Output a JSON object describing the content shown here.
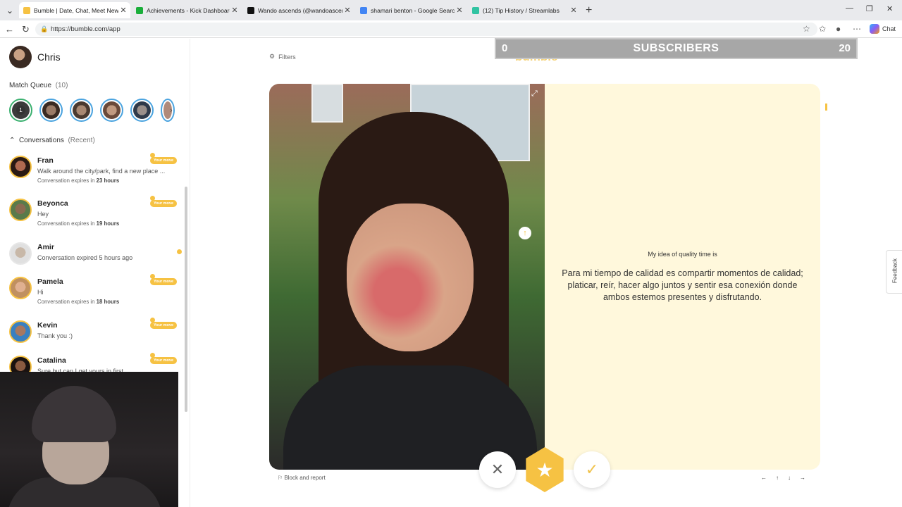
{
  "browser": {
    "tabs": [
      {
        "title": "Bumble | Date, Chat, Meet New Pe",
        "favicon": "bumble-icon",
        "color": "#f6c243",
        "active": true
      },
      {
        "title": "Achievements - Kick Dashboard",
        "favicon": "kick-icon",
        "color": "#1aae3a",
        "active": false
      },
      {
        "title": "Wando ascends (@wandoascends",
        "favicon": "tiktok-icon",
        "color": "#111111",
        "active": false
      },
      {
        "title": "shamari benton - Google Search",
        "favicon": "google-icon",
        "color": "#4285f4",
        "active": false
      },
      {
        "title": "(12) Tip History / Streamlabs",
        "favicon": "streamlabs-icon",
        "color": "#31c3a2",
        "active": false
      }
    ],
    "url": "https://bumble.com/app",
    "chat_label": "Chat"
  },
  "sidebar": {
    "user_name": "Chris",
    "match_queue_label": "Match Queue",
    "match_queue_count": "(10)",
    "queue_badge": "1",
    "conversations_label": "Conversations",
    "conversations_filter": "(Recent)",
    "your_move_label": "Your move",
    "conversations": [
      {
        "name": "Fran",
        "message": "Walk around the city/park, find a new place ...",
        "expiry_prefix": "Conversation expires in",
        "expiry": "23 hours",
        "your_move": true
      },
      {
        "name": "Beyonca",
        "message": "Hey",
        "expiry_prefix": "Conversation expires in",
        "expiry": "19 hours",
        "your_move": true
      },
      {
        "name": "Amir",
        "message": "Conversation expired 5 hours ago",
        "expiry_prefix": "",
        "expiry": "",
        "your_move": false
      },
      {
        "name": "Pamela",
        "message": "Hi",
        "expiry_prefix": "Conversation expires in",
        "expiry": "18 hours",
        "your_move": true
      },
      {
        "name": "Kevin",
        "message": "Thank you :)",
        "expiry_prefix": "",
        "expiry": "",
        "your_move": true
      },
      {
        "name": "Catalina",
        "message": "Sure but can I get yours in first",
        "expiry_prefix": "",
        "expiry": "",
        "your_move": true
      }
    ]
  },
  "main": {
    "filters_label": "Filters",
    "logo": "bumble",
    "prompt_question": "My idea of quality time is",
    "prompt_answer": "Para mi tiempo de calidad es compartir momentos de calidad; platicar, reír, hacer algo juntos y sentir esa conexión donde ambos estemos presentes y disfrutando.",
    "block_report_label": "Block and report",
    "feedback_label": "Feedback",
    "key_hints": [
      "←",
      "↑",
      "↓",
      "→"
    ]
  },
  "overlay": {
    "subscribers_left": "0",
    "subscribers_label": "SUBSCRIBERS",
    "subscribers_right": "20"
  },
  "colors": {
    "brand": "#f6c243",
    "card_bg": "#fff8dc"
  }
}
